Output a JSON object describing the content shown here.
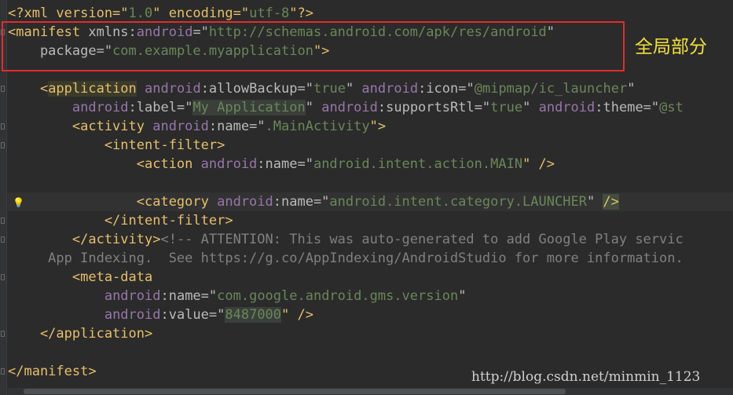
{
  "code_lines": [
    {
      "segments": [
        {
          "text": "<?xml version=\"",
          "cls": "t"
        },
        {
          "text": "1.0",
          "cls": "v"
        },
        {
          "text": "\" encoding=\"",
          "cls": "t"
        },
        {
          "text": "utf-8",
          "cls": "v"
        },
        {
          "text": "\"?>",
          "cls": "t"
        }
      ]
    },
    {
      "segments": [
        {
          "text": "<manifest ",
          "cls": "t"
        },
        {
          "text": "xmlns:",
          "cls": "a"
        },
        {
          "text": "android",
          "cls": "ns"
        },
        {
          "text": "=\"",
          "cls": "a"
        },
        {
          "text": "http://schemas.android.com/apk/res/android",
          "cls": "v"
        },
        {
          "text": "\"",
          "cls": "a"
        }
      ]
    },
    {
      "segments": [
        {
          "text": "    package=\"",
          "cls": "a"
        },
        {
          "text": "com.example.myapplication",
          "cls": "v"
        },
        {
          "text": "\">",
          "cls": "t"
        }
      ]
    },
    {
      "segments": []
    },
    {
      "segments": [
        {
          "text": "    <",
          "cls": "t"
        },
        {
          "text": "application",
          "cls": "t hl-tag"
        },
        {
          "text": " ",
          "cls": "t"
        },
        {
          "text": "android",
          "cls": "ns"
        },
        {
          "text": ":allowBackup=\"",
          "cls": "a"
        },
        {
          "text": "true",
          "cls": "v"
        },
        {
          "text": "\" ",
          "cls": "a"
        },
        {
          "text": "android",
          "cls": "ns"
        },
        {
          "text": ":icon=\"",
          "cls": "a"
        },
        {
          "text": "@mipmap/ic_launcher",
          "cls": "v"
        },
        {
          "text": "\"",
          "cls": "a"
        }
      ]
    },
    {
      "segments": [
        {
          "text": "        ",
          "cls": "a"
        },
        {
          "text": "android",
          "cls": "ns"
        },
        {
          "text": ":label=\"",
          "cls": "a"
        },
        {
          "text": "My Application",
          "cls": "v hl-val"
        },
        {
          "text": "\" ",
          "cls": "a"
        },
        {
          "text": "android",
          "cls": "ns"
        },
        {
          "text": ":supportsRtl=\"",
          "cls": "a"
        },
        {
          "text": "true",
          "cls": "v"
        },
        {
          "text": "\" ",
          "cls": "a"
        },
        {
          "text": "android",
          "cls": "ns"
        },
        {
          "text": ":theme=\"",
          "cls": "a"
        },
        {
          "text": "@st",
          "cls": "v"
        }
      ]
    },
    {
      "segments": [
        {
          "text": "        <activity ",
          "cls": "t"
        },
        {
          "text": "android",
          "cls": "ns"
        },
        {
          "text": ":name=\"",
          "cls": "a"
        },
        {
          "text": ".MainActivity",
          "cls": "v"
        },
        {
          "text": "\">",
          "cls": "t"
        }
      ]
    },
    {
      "segments": [
        {
          "text": "            <intent-filter>",
          "cls": "t"
        }
      ]
    },
    {
      "segments": [
        {
          "text": "                <action ",
          "cls": "t"
        },
        {
          "text": "android",
          "cls": "ns"
        },
        {
          "text": ":name=\"",
          "cls": "a"
        },
        {
          "text": "android.intent.action.MAIN",
          "cls": "v"
        },
        {
          "text": "\" />",
          "cls": "t"
        }
      ]
    },
    {
      "segments": []
    },
    {
      "segments": [
        {
          "text": "                <category ",
          "cls": "t"
        },
        {
          "text": "android",
          "cls": "ns"
        },
        {
          "text": ":name=\"",
          "cls": "a"
        },
        {
          "text": "android.intent.category.LAUNCHER",
          "cls": "v"
        },
        {
          "text": "\" ",
          "cls": "a"
        },
        {
          "text": "/>",
          "cls": "t hl-box"
        }
      ],
      "caret": true
    },
    {
      "segments": [
        {
          "text": "            </intent-filter>",
          "cls": "t"
        }
      ]
    },
    {
      "segments": [
        {
          "text": "        </activity>",
          "cls": "t"
        },
        {
          "text": "<!-- ATTENTION: This was auto-generated to add Google Play servic",
          "cls": "c"
        }
      ]
    },
    {
      "segments": [
        {
          "text": "     App Indexing.  See https://g.co/AppIndexing/AndroidStudio for more information.",
          "cls": "c"
        }
      ]
    },
    {
      "segments": [
        {
          "text": "        <meta-data",
          "cls": "t"
        }
      ]
    },
    {
      "segments": [
        {
          "text": "            ",
          "cls": "a"
        },
        {
          "text": "android",
          "cls": "ns"
        },
        {
          "text": ":name=\"",
          "cls": "a"
        },
        {
          "text": "com.google.android.gms.version",
          "cls": "v"
        },
        {
          "text": "\"",
          "cls": "a"
        }
      ]
    },
    {
      "segments": [
        {
          "text": "            ",
          "cls": "a"
        },
        {
          "text": "android",
          "cls": "ns"
        },
        {
          "text": ":value=\"",
          "cls": "a"
        },
        {
          "text": "8487000",
          "cls": "v hl-val"
        },
        {
          "text": "\" />",
          "cls": "t"
        }
      ]
    },
    {
      "segments": [
        {
          "text": "    </application>",
          "cls": "t"
        }
      ]
    },
    {
      "segments": []
    },
    {
      "segments": [
        {
          "text": "</manifest>",
          "cls": "t"
        }
      ]
    }
  ],
  "annotation": {
    "label": "全局部分",
    "color": "#f3e03b"
  },
  "watermark": "http://blog.csdn.net/minmin_1123",
  "colors": {
    "background": "#2b2b2b",
    "tag": "#e8bf6a",
    "attribute": "#bababa",
    "namespace": "#9876aa",
    "value": "#6a8759",
    "comment": "#808080",
    "highlight_box": "#e32b2b"
  },
  "icons": {
    "gutter_hint": "lightbulb-icon"
  }
}
